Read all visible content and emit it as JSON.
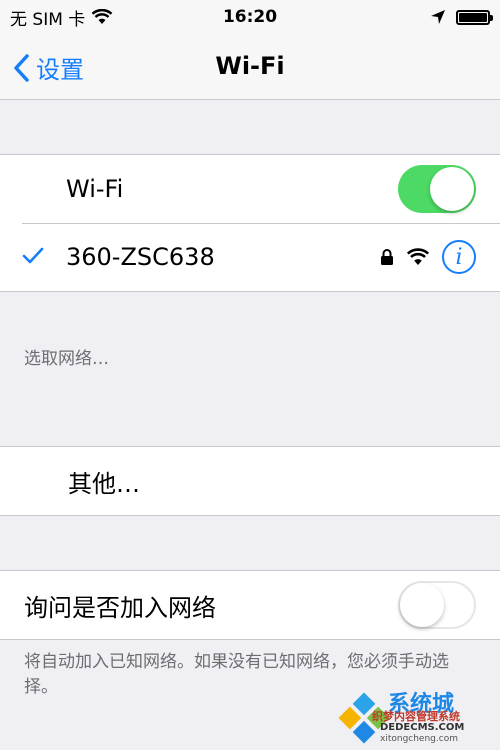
{
  "status_bar": {
    "carrier": "无 SIM 卡",
    "time": "16:20"
  },
  "nav": {
    "back_label": "设置",
    "title": "Wi-Fi"
  },
  "wifi_toggle": {
    "label": "Wi-Fi",
    "state": "on"
  },
  "connected_network": {
    "name": "360-ZSC638"
  },
  "choose_network": {
    "caption": "选取网络…"
  },
  "other": {
    "label": "其他…"
  },
  "ask_to_join": {
    "label": "询问是否加入网络",
    "state": "off",
    "note": "将自动加入已知网络。如果没有已知网络，您必须手动选择。"
  },
  "watermark": {
    "brand": "系统城",
    "line1": "织梦内容管理系统",
    "line2": "DEDECMS.COM",
    "line3": "xitongcheng.com"
  },
  "colors": {
    "accent": "#157efb",
    "switch_on": "#4cd964",
    "background": "#efeff4"
  }
}
